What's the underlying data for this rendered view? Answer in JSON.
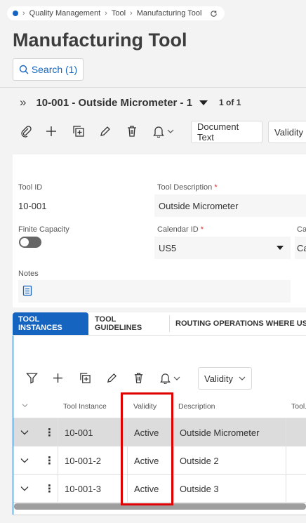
{
  "breadcrumb": {
    "items": [
      "Quality Management",
      "Tool",
      "Manufacturing Tool"
    ]
  },
  "page": {
    "title": "Manufacturing Tool",
    "search_label": "Search (1)"
  },
  "record": {
    "title": "10-001 - Outside Micrometer - 1",
    "count": "1 of 1"
  },
  "toolbar": {
    "document_text": "Document Text",
    "validity": "Validity"
  },
  "form": {
    "tool_id_label": "Tool ID",
    "tool_id_value": "10-001",
    "tool_desc_label": "Tool Description",
    "tool_desc_value": "Outside Micrometer",
    "finite_capacity_label": "Finite Capacity",
    "finite_capacity_on": false,
    "calendar_label": "Calendar ID",
    "calendar_value": "US5",
    "ca_label": "Ca",
    "ca_value": "Ca",
    "notes_label": "Notes",
    "required_mark": "*"
  },
  "tabs": [
    {
      "label": "TOOL INSTANCES",
      "active": true
    },
    {
      "label": "TOOL GUIDELINES",
      "active": false
    },
    {
      "label": "ROUTING OPERATIONS WHERE USE",
      "active": false
    }
  ],
  "grid": {
    "validity_button": "Validity",
    "columns": [
      "Tool Instance",
      "Validity",
      "Description",
      "Tool."
    ],
    "rows": [
      {
        "instance": "10-001",
        "validity": "Active",
        "description": "Outside Micrometer",
        "selected": true
      },
      {
        "instance": "10-001-2",
        "validity": "Active",
        "description": "Outside 2",
        "selected": false
      },
      {
        "instance": "10-001-3",
        "validity": "Active",
        "description": "Outside 3",
        "selected": false
      }
    ]
  },
  "colors": {
    "accent": "#1565c0",
    "highlight_box": "#e00000",
    "selected_row": "#dcdcdc"
  }
}
